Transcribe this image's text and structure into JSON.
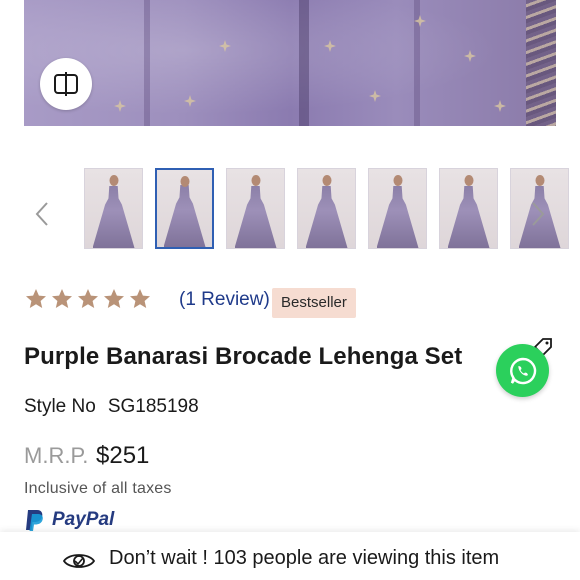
{
  "product": {
    "title": "Purple Banarasi Brocade Lehenga Set",
    "style_label": "Style No",
    "style_number": "SG185198",
    "mrp_label": "M.R.P.",
    "price": "$251",
    "tax_note": "Inclusive of all taxes",
    "rating": 5,
    "review_link": "(1 Review)",
    "badge": "Bestseller"
  },
  "gallery": {
    "thumbnail_count": 7,
    "active_index": 1
  },
  "payment": {
    "paypal_label": "PayPal"
  },
  "banner": {
    "message": "Don’t wait ! 103 people are viewing this item"
  },
  "colors": {
    "star": "#b99378",
    "review_link": "#1f3a8a",
    "badge_bg": "#f6dcd1",
    "whatsapp": "#2bd05c",
    "active_thumb_border": "#2f5fb3",
    "paypal_dark": "#253b80",
    "paypal_light": "#179bd7"
  },
  "icons": {
    "compare": "compare-icon",
    "prev": "chevron-left-icon",
    "next": "chevron-right-icon",
    "star": "star-icon",
    "whatsapp": "whatsapp-icon",
    "tag": "tag-icon",
    "eye": "eye-icon",
    "paypal": "paypal-logo"
  }
}
